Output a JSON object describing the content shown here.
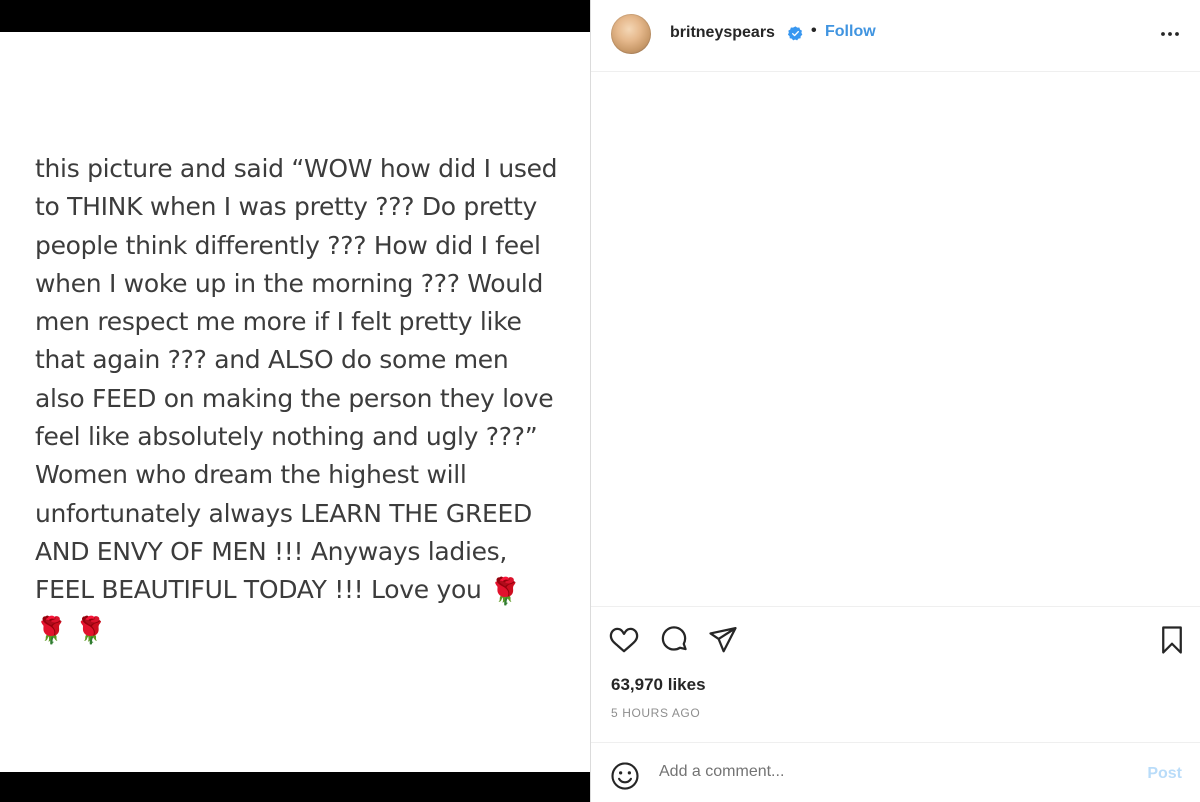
{
  "post": {
    "text_lines": [
      "this picture and said “WOW how did I used",
      "to THINK when I was pretty ??? Do pretty",
      "people think differently ??? How did I feel",
      "when I woke up in the morning ??? Would",
      "men respect me more if I felt pretty like",
      "that again ??? and ALSO do some men",
      "also FEED on making the person they love",
      "feel like absolutely nothing and ugly ???”",
      "Women who dream the highest will",
      "unfortunately always LEARN THE GREED",
      "AND ENVY OF MEN !!! Anyways ladies,",
      "FEEL BEAUTIFUL TODAY !!! Love you"
    ],
    "emoji": "🌹"
  },
  "header": {
    "username": "britneyspears",
    "separator": "•",
    "follow_label": "Follow",
    "verified_icon": "verified-badge-icon",
    "more_icon": "more-options-icon"
  },
  "actions": {
    "icons": [
      "heart-icon",
      "comment-icon",
      "share-icon",
      "bookmark-icon"
    ],
    "likes": "63,970 likes",
    "time": "5 HOURS AGO"
  },
  "comment": {
    "placeholder": "Add a comment...",
    "post_label": "Post",
    "emoji_icon": "emoji-icon"
  },
  "colors": {
    "accent": "#4094e0",
    "post_disabled": "#b9dcf9",
    "verified": "#3897f0"
  }
}
